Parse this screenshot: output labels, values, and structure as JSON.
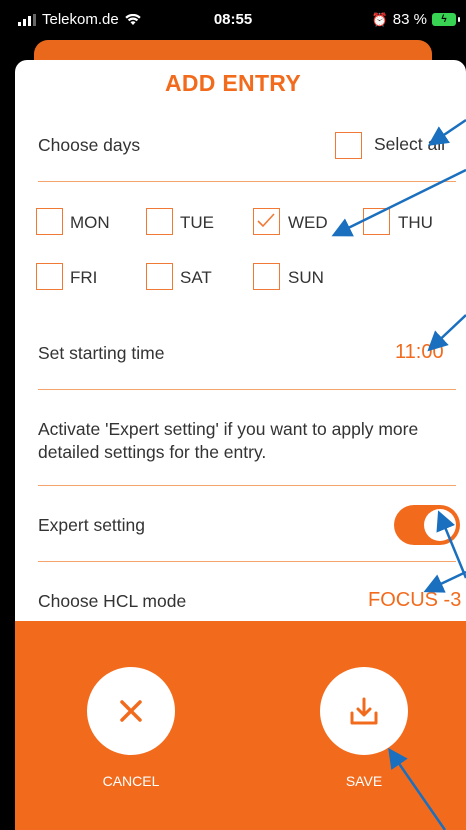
{
  "status": {
    "carrier": "Telekom.de",
    "time": "08:55",
    "battery": "83 %"
  },
  "dialog": {
    "title": "ADD ENTRY",
    "choose_days_label": "Choose days",
    "select_all_label": "Select all",
    "days": [
      {
        "label": "MON",
        "checked": false
      },
      {
        "label": "TUE",
        "checked": false
      },
      {
        "label": "WED",
        "checked": true
      },
      {
        "label": "THU",
        "checked": false
      },
      {
        "label": "FRI",
        "checked": false
      },
      {
        "label": "SAT",
        "checked": false
      },
      {
        "label": "SUN",
        "checked": false
      }
    ],
    "start_time_label": "Set starting time",
    "start_time_value": "11:00",
    "expert_info": "Activate 'Expert setting' if you want to apply more detailed settings for the entry.",
    "expert_label": "Expert setting",
    "expert_enabled": true,
    "hcl_label": "Choose HCL mode",
    "hcl_value": "FOCUS -3"
  },
  "actions": {
    "cancel_label": "CANCEL",
    "save_label": "SAVE"
  },
  "colors": {
    "accent": "#f26b1d",
    "annotation": "#1a6fbf"
  }
}
